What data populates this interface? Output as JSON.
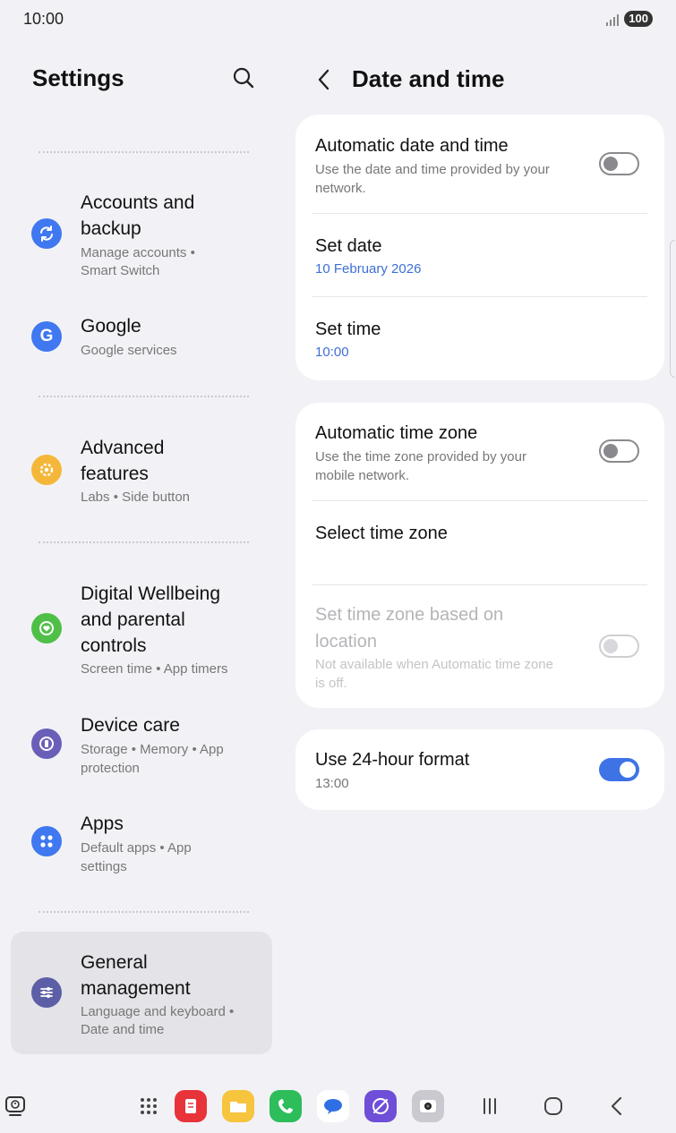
{
  "status": {
    "time": "10:00",
    "battery": "100"
  },
  "left": {
    "title": "Settings",
    "items": [
      {
        "title_line1": "Accounts and",
        "title_line2": "backup",
        "sub_line1": "Manage accounts  •",
        "sub_line2": "Smart Switch",
        "icon": "sync-icon",
        "color": "#3f78f0"
      },
      {
        "title_line1": "Google",
        "sub_line1": "Google services",
        "icon": "google-icon",
        "color": "#3f78f0"
      },
      {
        "title_line1": "Advanced",
        "title_line2": "features",
        "sub_line1": "Labs  •  Side button",
        "icon": "gear-plus-icon",
        "color": "#f5b739"
      },
      {
        "title_line1": "Digital Wellbeing",
        "title_line2": "and parental",
        "title_line3": "controls",
        "sub_line1": "Screen time  •  App timers",
        "icon": "wellbeing-icon",
        "color": "#4fbf48"
      },
      {
        "title_line1": "Device care",
        "sub_line1": "Storage  •  Memory  •  App",
        "sub_line2": "protection",
        "icon": "device-care-icon",
        "color": "#6a5fb8"
      },
      {
        "title_line1": "Apps",
        "sub_line1": "Default apps  •  App",
        "sub_line2": "settings",
        "icon": "apps-grid-icon",
        "color": "#3f78f0"
      },
      {
        "title_line1": "General",
        "title_line2": "management",
        "sub_line1": "Language and keyboard  •",
        "sub_line2": "Date and time",
        "icon": "sliders-icon",
        "color": "#5c5fa6"
      }
    ]
  },
  "right": {
    "title": "Date and time",
    "card1": {
      "auto_dt": {
        "title": "Automatic date and time",
        "desc_line1": "Use the date and time provided by your",
        "desc_line2": "network.",
        "toggle": "off"
      },
      "set_date": {
        "title": "Set date",
        "value": "10 February 2026"
      },
      "set_time": {
        "title": "Set time",
        "value": "10:00"
      }
    },
    "card2": {
      "auto_tz": {
        "title": "Automatic time zone",
        "desc_line1": "Use the time zone provided by your",
        "desc_line2": "mobile network.",
        "toggle": "off"
      },
      "select_tz": {
        "title": "Select time zone"
      },
      "tz_location": {
        "title_line1": "Set time zone based on",
        "title_line2": "location",
        "desc_line1": "Not available when Automatic time zone",
        "desc_line2": "is off.",
        "toggle": "disabled"
      }
    },
    "card3": {
      "fmt24": {
        "title": "Use 24-hour format",
        "value": "13:00",
        "toggle": "on"
      }
    }
  },
  "colors": {
    "accent": "#3e73e6",
    "link": "#3e6fd6",
    "background": "#f2f2f6"
  },
  "taskbar": {
    "apps": [
      {
        "name": "notes-app-icon",
        "color": "#e8333a"
      },
      {
        "name": "my-files-icon",
        "color": "#f6c43d"
      },
      {
        "name": "phone-icon",
        "color": "#2dbd5b"
      },
      {
        "name": "messages-icon",
        "color": "#2f6fe3"
      },
      {
        "name": "internet-icon",
        "color": "#6f4fd8"
      },
      {
        "name": "camera-icon",
        "color": "#c9c9cf"
      }
    ]
  }
}
